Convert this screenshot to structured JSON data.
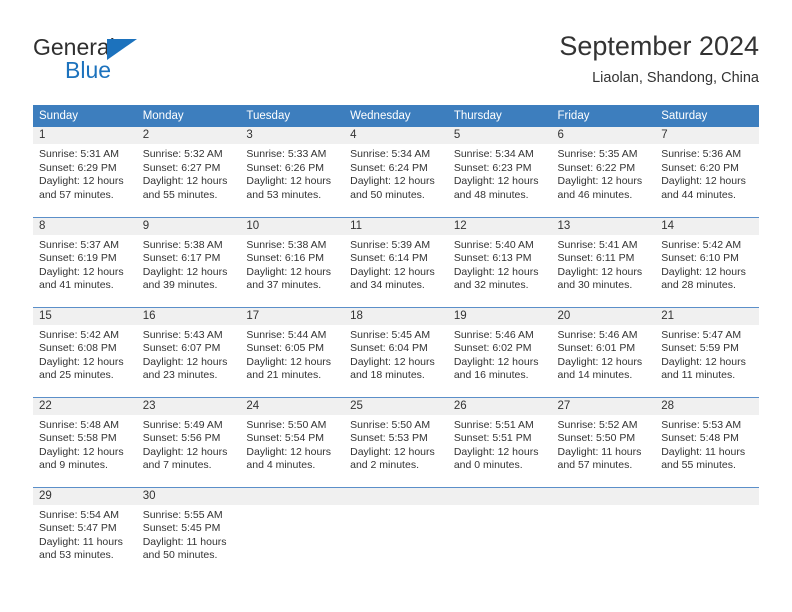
{
  "brand": {
    "name_top": "General",
    "name_bottom": "Blue",
    "accent_color": "#1c72bd"
  },
  "header": {
    "title": "September 2024",
    "subtitle": "Liaolan, Shandong, China"
  },
  "theme": {
    "header_row_bg": "#3d7ebe",
    "daynum_bg": "#f0f0f0",
    "row_divider": "#5b8fc9",
    "text": "#333333"
  },
  "weekdays": [
    "Sunday",
    "Monday",
    "Tuesday",
    "Wednesday",
    "Thursday",
    "Friday",
    "Saturday"
  ],
  "labels": {
    "sunrise": "Sunrise:",
    "sunset": "Sunset:",
    "daylight": "Daylight:"
  },
  "weeks": [
    [
      {
        "day": "1",
        "sunrise": "Sunrise: 5:31 AM",
        "sunset": "Sunset: 6:29 PM",
        "daylight_1": "Daylight: 12 hours",
        "daylight_2": "and 57 minutes."
      },
      {
        "day": "2",
        "sunrise": "Sunrise: 5:32 AM",
        "sunset": "Sunset: 6:27 PM",
        "daylight_1": "Daylight: 12 hours",
        "daylight_2": "and 55 minutes."
      },
      {
        "day": "3",
        "sunrise": "Sunrise: 5:33 AM",
        "sunset": "Sunset: 6:26 PM",
        "daylight_1": "Daylight: 12 hours",
        "daylight_2": "and 53 minutes."
      },
      {
        "day": "4",
        "sunrise": "Sunrise: 5:34 AM",
        "sunset": "Sunset: 6:24 PM",
        "daylight_1": "Daylight: 12 hours",
        "daylight_2": "and 50 minutes."
      },
      {
        "day": "5",
        "sunrise": "Sunrise: 5:34 AM",
        "sunset": "Sunset: 6:23 PM",
        "daylight_1": "Daylight: 12 hours",
        "daylight_2": "and 48 minutes."
      },
      {
        "day": "6",
        "sunrise": "Sunrise: 5:35 AM",
        "sunset": "Sunset: 6:22 PM",
        "daylight_1": "Daylight: 12 hours",
        "daylight_2": "and 46 minutes."
      },
      {
        "day": "7",
        "sunrise": "Sunrise: 5:36 AM",
        "sunset": "Sunset: 6:20 PM",
        "daylight_1": "Daylight: 12 hours",
        "daylight_2": "and 44 minutes."
      }
    ],
    [
      {
        "day": "8",
        "sunrise": "Sunrise: 5:37 AM",
        "sunset": "Sunset: 6:19 PM",
        "daylight_1": "Daylight: 12 hours",
        "daylight_2": "and 41 minutes."
      },
      {
        "day": "9",
        "sunrise": "Sunrise: 5:38 AM",
        "sunset": "Sunset: 6:17 PM",
        "daylight_1": "Daylight: 12 hours",
        "daylight_2": "and 39 minutes."
      },
      {
        "day": "10",
        "sunrise": "Sunrise: 5:38 AM",
        "sunset": "Sunset: 6:16 PM",
        "daylight_1": "Daylight: 12 hours",
        "daylight_2": "and 37 minutes."
      },
      {
        "day": "11",
        "sunrise": "Sunrise: 5:39 AM",
        "sunset": "Sunset: 6:14 PM",
        "daylight_1": "Daylight: 12 hours",
        "daylight_2": "and 34 minutes."
      },
      {
        "day": "12",
        "sunrise": "Sunrise: 5:40 AM",
        "sunset": "Sunset: 6:13 PM",
        "daylight_1": "Daylight: 12 hours",
        "daylight_2": "and 32 minutes."
      },
      {
        "day": "13",
        "sunrise": "Sunrise: 5:41 AM",
        "sunset": "Sunset: 6:11 PM",
        "daylight_1": "Daylight: 12 hours",
        "daylight_2": "and 30 minutes."
      },
      {
        "day": "14",
        "sunrise": "Sunrise: 5:42 AM",
        "sunset": "Sunset: 6:10 PM",
        "daylight_1": "Daylight: 12 hours",
        "daylight_2": "and 28 minutes."
      }
    ],
    [
      {
        "day": "15",
        "sunrise": "Sunrise: 5:42 AM",
        "sunset": "Sunset: 6:08 PM",
        "daylight_1": "Daylight: 12 hours",
        "daylight_2": "and 25 minutes."
      },
      {
        "day": "16",
        "sunrise": "Sunrise: 5:43 AM",
        "sunset": "Sunset: 6:07 PM",
        "daylight_1": "Daylight: 12 hours",
        "daylight_2": "and 23 minutes."
      },
      {
        "day": "17",
        "sunrise": "Sunrise: 5:44 AM",
        "sunset": "Sunset: 6:05 PM",
        "daylight_1": "Daylight: 12 hours",
        "daylight_2": "and 21 minutes."
      },
      {
        "day": "18",
        "sunrise": "Sunrise: 5:45 AM",
        "sunset": "Sunset: 6:04 PM",
        "daylight_1": "Daylight: 12 hours",
        "daylight_2": "and 18 minutes."
      },
      {
        "day": "19",
        "sunrise": "Sunrise: 5:46 AM",
        "sunset": "Sunset: 6:02 PM",
        "daylight_1": "Daylight: 12 hours",
        "daylight_2": "and 16 minutes."
      },
      {
        "day": "20",
        "sunrise": "Sunrise: 5:46 AM",
        "sunset": "Sunset: 6:01 PM",
        "daylight_1": "Daylight: 12 hours",
        "daylight_2": "and 14 minutes."
      },
      {
        "day": "21",
        "sunrise": "Sunrise: 5:47 AM",
        "sunset": "Sunset: 5:59 PM",
        "daylight_1": "Daylight: 12 hours",
        "daylight_2": "and 11 minutes."
      }
    ],
    [
      {
        "day": "22",
        "sunrise": "Sunrise: 5:48 AM",
        "sunset": "Sunset: 5:58 PM",
        "daylight_1": "Daylight: 12 hours",
        "daylight_2": "and 9 minutes."
      },
      {
        "day": "23",
        "sunrise": "Sunrise: 5:49 AM",
        "sunset": "Sunset: 5:56 PM",
        "daylight_1": "Daylight: 12 hours",
        "daylight_2": "and 7 minutes."
      },
      {
        "day": "24",
        "sunrise": "Sunrise: 5:50 AM",
        "sunset": "Sunset: 5:54 PM",
        "daylight_1": "Daylight: 12 hours",
        "daylight_2": "and 4 minutes."
      },
      {
        "day": "25",
        "sunrise": "Sunrise: 5:50 AM",
        "sunset": "Sunset: 5:53 PM",
        "daylight_1": "Daylight: 12 hours",
        "daylight_2": "and 2 minutes."
      },
      {
        "day": "26",
        "sunrise": "Sunrise: 5:51 AM",
        "sunset": "Sunset: 5:51 PM",
        "daylight_1": "Daylight: 12 hours",
        "daylight_2": "and 0 minutes."
      },
      {
        "day": "27",
        "sunrise": "Sunrise: 5:52 AM",
        "sunset": "Sunset: 5:50 PM",
        "daylight_1": "Daylight: 11 hours",
        "daylight_2": "and 57 minutes."
      },
      {
        "day": "28",
        "sunrise": "Sunrise: 5:53 AM",
        "sunset": "Sunset: 5:48 PM",
        "daylight_1": "Daylight: 11 hours",
        "daylight_2": "and 55 minutes."
      }
    ],
    [
      {
        "day": "29",
        "sunrise": "Sunrise: 5:54 AM",
        "sunset": "Sunset: 5:47 PM",
        "daylight_1": "Daylight: 11 hours",
        "daylight_2": "and 53 minutes."
      },
      {
        "day": "30",
        "sunrise": "Sunrise: 5:55 AM",
        "sunset": "Sunset: 5:45 PM",
        "daylight_1": "Daylight: 11 hours",
        "daylight_2": "and 50 minutes."
      },
      {
        "day": "",
        "sunrise": "",
        "sunset": "",
        "daylight_1": "",
        "daylight_2": ""
      },
      {
        "day": "",
        "sunrise": "",
        "sunset": "",
        "daylight_1": "",
        "daylight_2": ""
      },
      {
        "day": "",
        "sunrise": "",
        "sunset": "",
        "daylight_1": "",
        "daylight_2": ""
      },
      {
        "day": "",
        "sunrise": "",
        "sunset": "",
        "daylight_1": "",
        "daylight_2": ""
      },
      {
        "day": "",
        "sunrise": "",
        "sunset": "",
        "daylight_1": "",
        "daylight_2": ""
      }
    ]
  ]
}
